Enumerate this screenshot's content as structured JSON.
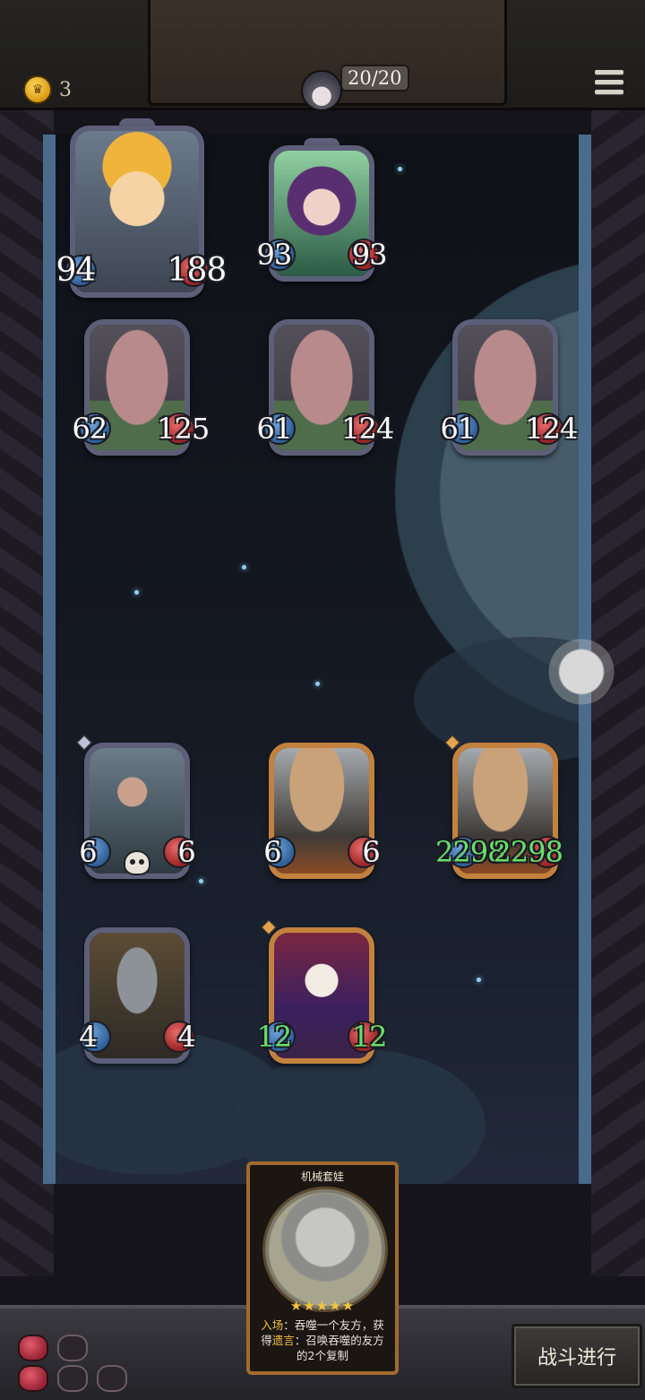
{
  "top_bar": {
    "gold": "3",
    "health": "20/20"
  },
  "enemy_board": [
    {
      "name": "boy",
      "attack": "94",
      "health": "188",
      "size": "large",
      "frame": "silver"
    },
    {
      "name": "witch",
      "attack": "93",
      "health": "93",
      "frame": "silver"
    },
    {
      "name": "goblin-1",
      "attack": "62",
      "health": "125",
      "frame": "silver"
    },
    {
      "name": "goblin-2",
      "attack": "61",
      "health": "124",
      "frame": "silver"
    },
    {
      "name": "goblin-3",
      "attack": "61",
      "health": "124",
      "frame": "silver"
    }
  ],
  "player_board": [
    {
      "name": "mech-pilot",
      "attack": "6",
      "health": "6",
      "frame": "silver",
      "deathrattle": true
    },
    {
      "name": "zeppelin",
      "attack": "6",
      "health": "6",
      "frame": "gold"
    },
    {
      "name": "zeppelin-buffed",
      "attack": "2298",
      "health": "2298",
      "frame": "gold",
      "buffed": true
    },
    {
      "name": "tin-robot",
      "attack": "4",
      "health": "4",
      "frame": "silver"
    },
    {
      "name": "clown",
      "attack": "12",
      "health": "12",
      "frame": "gold",
      "buffed": true
    }
  ],
  "hand_card": {
    "title": "机械套娃",
    "stars": "★★★★★",
    "desc_kw1": "入场",
    "desc_part1": "：吞噬一个友方，获得",
    "desc_kw2": "遗言",
    "desc_part2": "：召唤吞噬的友方的2个复制"
  },
  "lives": {
    "filled": 2,
    "total": 5
  },
  "battle_button": "战斗进行",
  "colors": {
    "buff_stat": "#66e06a",
    "gold_frame": "#c3813e",
    "silver_frame": "#5d5f79",
    "keyword": "#f1c043"
  }
}
